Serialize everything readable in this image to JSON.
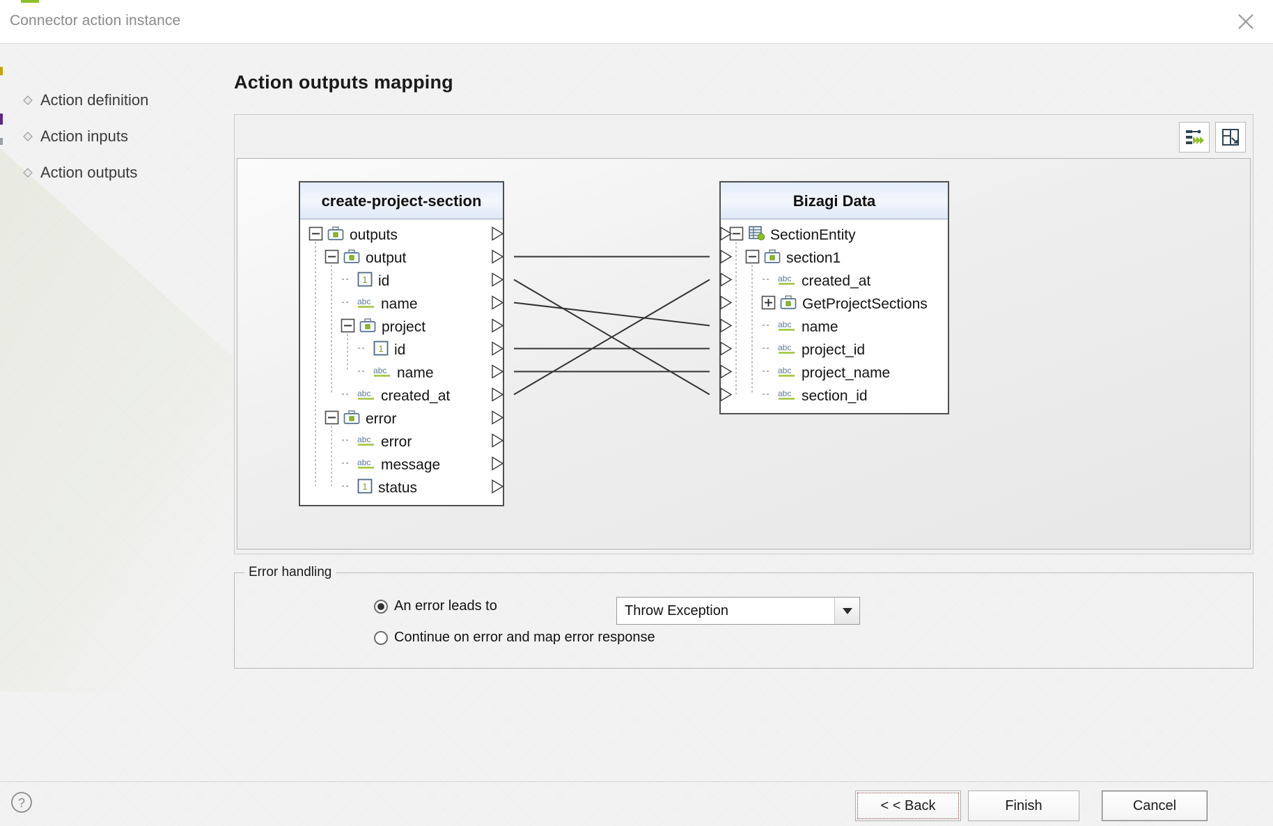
{
  "window": {
    "title": "Connector action instance",
    "close_icon": "close-icon"
  },
  "sidebar": {
    "items": [
      {
        "label": "Action definition"
      },
      {
        "label": "Action inputs"
      },
      {
        "label": "Action outputs"
      }
    ]
  },
  "main": {
    "page_title": "Action outputs mapping",
    "toolbar": [
      {
        "name": "auto-map-icon",
        "tooltip": "Auto map"
      },
      {
        "name": "expand-layout-icon",
        "tooltip": "Expand"
      }
    ]
  },
  "mapping": {
    "source": {
      "title": "create-project-section",
      "nodes": [
        {
          "label": "outputs",
          "indent": 0,
          "icon": "case-icon",
          "toggle": "minus",
          "port": true
        },
        {
          "label": "output",
          "indent": 1,
          "icon": "case-icon",
          "toggle": "minus",
          "port": true
        },
        {
          "label": "id",
          "indent": 2,
          "icon": "number-icon",
          "toggle": "none",
          "port": true
        },
        {
          "label": "name",
          "indent": 2,
          "icon": "abc-icon",
          "toggle": "none",
          "port": true
        },
        {
          "label": "project",
          "indent": 2,
          "icon": "case-icon",
          "toggle": "minus",
          "port": true
        },
        {
          "label": "id",
          "indent": 3,
          "icon": "number-icon",
          "toggle": "none",
          "port": true
        },
        {
          "label": "name",
          "indent": 3,
          "icon": "abc-icon",
          "toggle": "none",
          "port": true
        },
        {
          "label": "created_at",
          "indent": 2,
          "icon": "abc-icon",
          "toggle": "none",
          "port": true
        },
        {
          "label": "error",
          "indent": 1,
          "icon": "case-icon",
          "toggle": "minus",
          "port": true
        },
        {
          "label": "error",
          "indent": 2,
          "icon": "abc-icon",
          "toggle": "none",
          "port": true
        },
        {
          "label": "message",
          "indent": 2,
          "icon": "abc-icon",
          "toggle": "none",
          "port": true
        },
        {
          "label": "status",
          "indent": 2,
          "icon": "number-icon",
          "toggle": "none",
          "port": true
        }
      ]
    },
    "target": {
      "title": "Bizagi Data",
      "nodes": [
        {
          "label": "SectionEntity",
          "indent": 0,
          "icon": "entity-icon",
          "toggle": "minus",
          "port": true
        },
        {
          "label": "section1",
          "indent": 1,
          "icon": "case-icon",
          "toggle": "minus",
          "port": true
        },
        {
          "label": "created_at",
          "indent": 2,
          "icon": "abc-icon",
          "toggle": "none",
          "port": true
        },
        {
          "label": "GetProjectSections",
          "indent": 2,
          "icon": "case-icon",
          "toggle": "plus",
          "port": true
        },
        {
          "label": "name",
          "indent": 2,
          "icon": "abc-icon",
          "toggle": "none",
          "port": true
        },
        {
          "label": "project_id",
          "indent": 2,
          "icon": "abc-icon",
          "toggle": "none",
          "port": true
        },
        {
          "label": "project_name",
          "indent": 2,
          "icon": "abc-icon",
          "toggle": "none",
          "port": true
        },
        {
          "label": "section_id",
          "indent": 2,
          "icon": "abc-icon",
          "toggle": "none",
          "port": true
        }
      ]
    },
    "links": [
      {
        "from": "output",
        "to": "section1"
      },
      {
        "from": "id",
        "to": "section_id"
      },
      {
        "from": "name",
        "to": "name"
      },
      {
        "from": "id2",
        "to": "project_id"
      },
      {
        "from": "name2",
        "to": "project_name"
      },
      {
        "from": "created_at",
        "to": "created_at"
      }
    ]
  },
  "error_handling": {
    "legend": "Error handling",
    "option_1": "An error leads to",
    "option_2": "Continue on error and map error response",
    "selected_option": 1,
    "select_value": "Throw Exception"
  },
  "footer": {
    "help_icon": "help-icon",
    "back_label": "< < Back",
    "finish_label": "Finish",
    "cancel_label": "Cancel"
  },
  "colors": {
    "accent_green": "#8cbf26",
    "header_blue": "#e3ecfa",
    "text": "#141414"
  }
}
